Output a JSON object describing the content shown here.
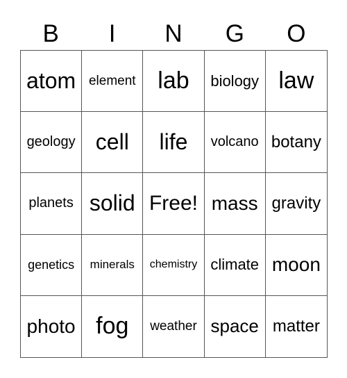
{
  "header": [
    "B",
    "I",
    "N",
    "G",
    "O"
  ],
  "cells": [
    [
      "atom",
      "element",
      "lab",
      "biology",
      "law"
    ],
    [
      "geology",
      "cell",
      "life",
      "volcano",
      "botany"
    ],
    [
      "planets",
      "solid",
      "Free!",
      "mass",
      "gravity"
    ],
    [
      "genetics",
      "minerals",
      "chemistry",
      "climate",
      "moon"
    ],
    [
      "photo",
      "fog",
      "weather",
      "space",
      "matter"
    ]
  ]
}
